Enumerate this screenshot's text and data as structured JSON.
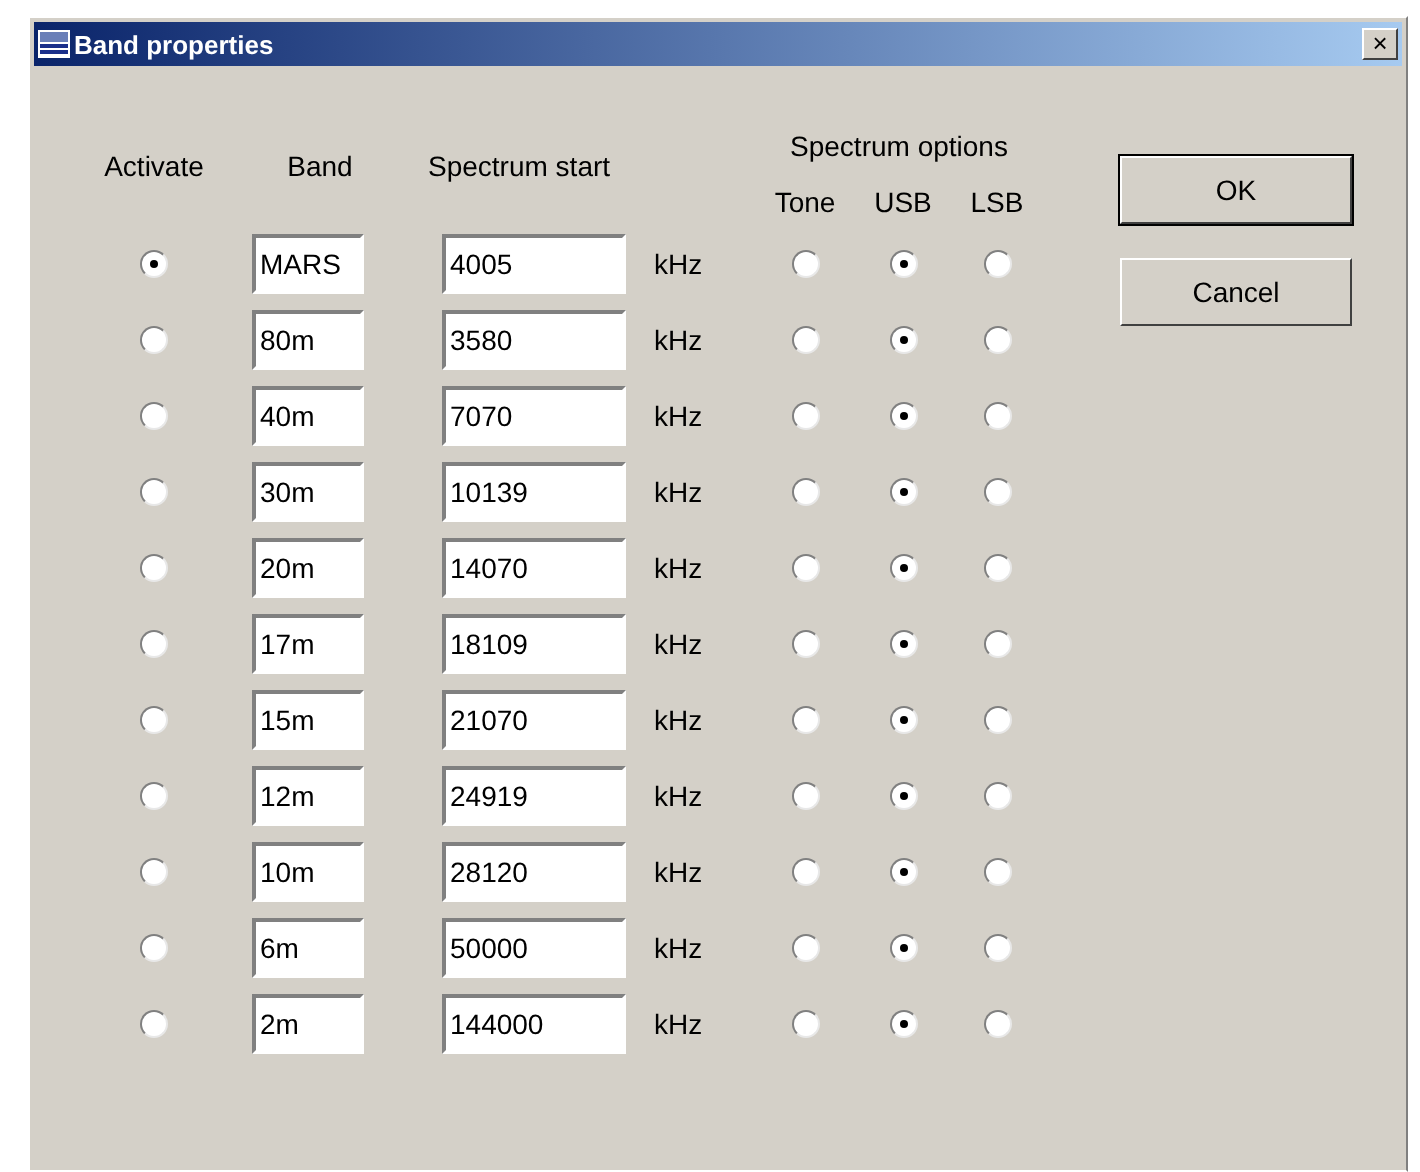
{
  "window": {
    "title": "Band properties",
    "close": "×"
  },
  "headers": {
    "activate": "Activate",
    "band": "Band",
    "start": "Spectrum start",
    "options": "Spectrum options",
    "option_labels": [
      "Tone",
      "USB",
      "LSB"
    ]
  },
  "rows": [
    {
      "activate": {
        "selected": true
      },
      "band": "MARS",
      "start": "4005",
      "unit": "kHz",
      "options": [
        {
          "selected": false
        },
        {
          "selected": true
        },
        {
          "selected": false
        }
      ]
    },
    {
      "activate": {
        "selected": false
      },
      "band": "80m",
      "start": "3580",
      "unit": "kHz",
      "options": [
        {
          "selected": false
        },
        {
          "selected": true
        },
        {
          "selected": false
        }
      ]
    },
    {
      "activate": {
        "selected": false
      },
      "band": "40m",
      "start": "7070",
      "unit": "kHz",
      "options": [
        {
          "selected": false
        },
        {
          "selected": true
        },
        {
          "selected": false
        }
      ]
    },
    {
      "activate": {
        "selected": false
      },
      "band": "30m",
      "start": "10139",
      "unit": "kHz",
      "options": [
        {
          "selected": false
        },
        {
          "selected": true
        },
        {
          "selected": false
        }
      ]
    },
    {
      "activate": {
        "selected": false
      },
      "band": "20m",
      "start": "14070",
      "unit": "kHz",
      "options": [
        {
          "selected": false
        },
        {
          "selected": true
        },
        {
          "selected": false
        }
      ]
    },
    {
      "activate": {
        "selected": false
      },
      "band": "17m",
      "start": "18109",
      "unit": "kHz",
      "options": [
        {
          "selected": false
        },
        {
          "selected": true
        },
        {
          "selected": false
        }
      ]
    },
    {
      "activate": {
        "selected": false
      },
      "band": "15m",
      "start": "21070",
      "unit": "kHz",
      "options": [
        {
          "selected": false
        },
        {
          "selected": true
        },
        {
          "selected": false
        }
      ]
    },
    {
      "activate": {
        "selected": false
      },
      "band": "12m",
      "start": "24919",
      "unit": "kHz",
      "options": [
        {
          "selected": false
        },
        {
          "selected": true
        },
        {
          "selected": false
        }
      ]
    },
    {
      "activate": {
        "selected": false
      },
      "band": "10m",
      "start": "28120",
      "unit": "kHz",
      "options": [
        {
          "selected": false
        },
        {
          "selected": true
        },
        {
          "selected": false
        }
      ]
    },
    {
      "activate": {
        "selected": false
      },
      "band": "6m",
      "start": "50000",
      "unit": "kHz",
      "options": [
        {
          "selected": false
        },
        {
          "selected": true
        },
        {
          "selected": false
        }
      ]
    },
    {
      "activate": {
        "selected": false
      },
      "band": "2m",
      "start": "144000",
      "unit": "kHz",
      "options": [
        {
          "selected": false
        },
        {
          "selected": true
        },
        {
          "selected": false
        }
      ]
    }
  ],
  "buttons": [
    "OK",
    "Cancel"
  ]
}
